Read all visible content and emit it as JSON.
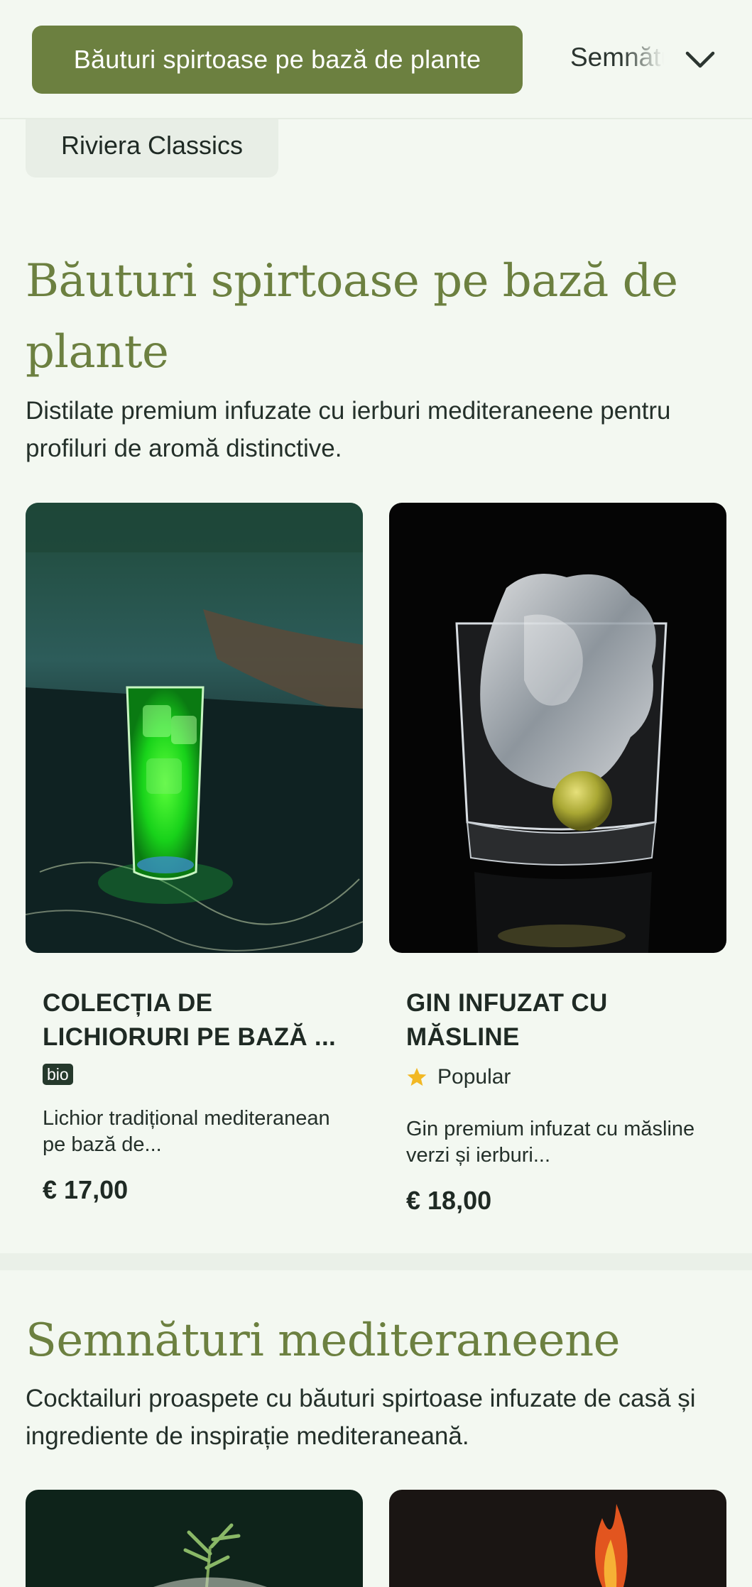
{
  "nav": {
    "active_category": "Băuturi spirtoase pe bază de plante",
    "next_category": "Semnături mediteraneene",
    "previous_category": "Riviera Classics"
  },
  "sections": [
    {
      "title": "Băuturi spirtoase pe bază de plante",
      "description": "Distilate premium infuzate cu ierburi mediteraneene pentru profiluri de aromă distinctive.",
      "products": [
        {
          "name": "COLECȚIA DE LICHIORURI PE BAZĂ ...",
          "badge": "bio",
          "description": "Lichior tradițional mediteranean pe bază de...",
          "price": "€ 17,00",
          "image": "green-liqueur-glass"
        },
        {
          "name": "GIN INFUZAT CU MĂSLINE",
          "tag": "Popular",
          "tag_icon": "star-icon",
          "description": "Gin premium infuzat cu măsline verzi și ierburi...",
          "price": "€ 18,00",
          "image": "gin-with-olive"
        }
      ]
    },
    {
      "title": "Semnături mediteraneene",
      "description": "Cocktailuri proaspete cu băuturi spirtoase infuzate de casă și ingrediente de inspirație mediteraneană."
    }
  ],
  "colors": {
    "background": "#f3f8f1",
    "accent": "#6c8040",
    "text": "#1f2a24",
    "badge": "#25392c",
    "star": "#f2b824"
  }
}
